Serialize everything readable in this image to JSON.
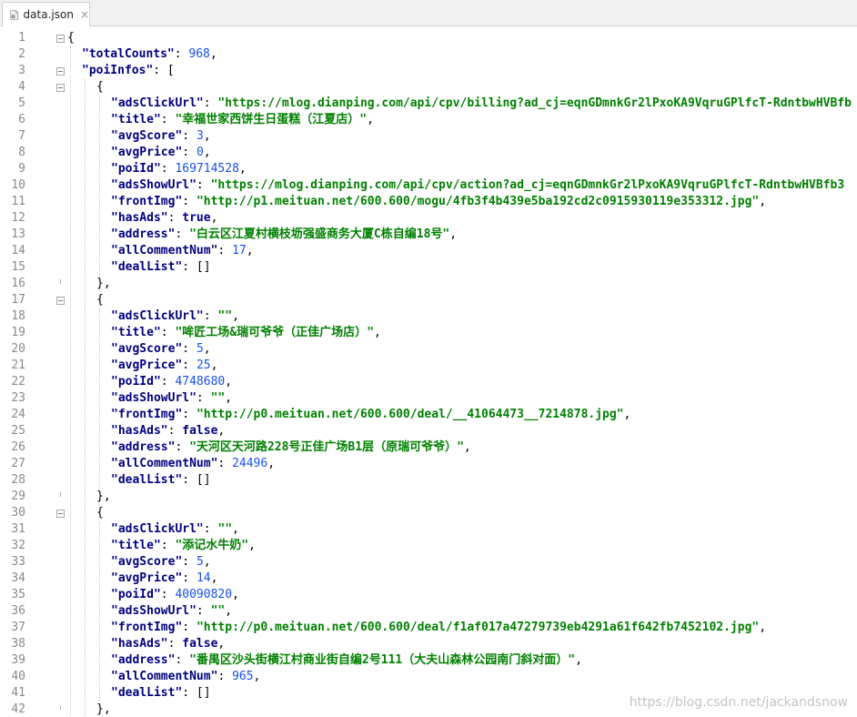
{
  "tab": {
    "label": "data.json",
    "close_glyph": "×",
    "icon": "json-file-icon"
  },
  "watermark": "https://blog.csdn.net/jackandsnow",
  "lines": [
    {
      "n": "1",
      "indent": 0,
      "t": [
        [
          "p",
          "{"
        ]
      ],
      "fold": "open"
    },
    {
      "n": "2",
      "indent": 1,
      "t": [
        [
          "ks",
          "\"totalCounts\""
        ],
        [
          "p",
          ": "
        ],
        [
          "n",
          "968"
        ],
        [
          "p",
          ","
        ]
      ]
    },
    {
      "n": "3",
      "indent": 1,
      "t": [
        [
          "ks",
          "\"poiInfos\""
        ],
        [
          "p",
          ": ["
        ]
      ],
      "fold": "open"
    },
    {
      "n": "4",
      "indent": 2,
      "t": [
        [
          "p",
          "{"
        ]
      ],
      "fold": "open"
    },
    {
      "n": "5",
      "indent": 3,
      "t": [
        [
          "ks",
          "\"adsClickUrl\""
        ],
        [
          "p",
          ": "
        ],
        [
          "s",
          "\"https://mlog.dianping.com/api/cpv/billing?ad_cj=eqnGDmnkGr2lPxoKA9VqruGPlfcT-RdntbwHVBfb"
        ]
      ]
    },
    {
      "n": "6",
      "indent": 3,
      "t": [
        [
          "ks",
          "\"title\""
        ],
        [
          "p",
          ": "
        ],
        [
          "s",
          "\"幸福世家西饼生日蛋糕（江夏店）\""
        ],
        [
          "p",
          ","
        ]
      ]
    },
    {
      "n": "7",
      "indent": 3,
      "t": [
        [
          "ks",
          "\"avgScore\""
        ],
        [
          "p",
          ": "
        ],
        [
          "n",
          "3"
        ],
        [
          "p",
          ","
        ]
      ]
    },
    {
      "n": "8",
      "indent": 3,
      "t": [
        [
          "ks",
          "\"avgPrice\""
        ],
        [
          "p",
          ": "
        ],
        [
          "n",
          "0"
        ],
        [
          "p",
          ","
        ]
      ]
    },
    {
      "n": "9",
      "indent": 3,
      "t": [
        [
          "ks",
          "\"poiId\""
        ],
        [
          "p",
          ": "
        ],
        [
          "n",
          "169714528"
        ],
        [
          "p",
          ","
        ]
      ]
    },
    {
      "n": "10",
      "indent": 3,
      "t": [
        [
          "ks",
          "\"adsShowUrl\""
        ],
        [
          "p",
          ": "
        ],
        [
          "s",
          "\"https://mlog.dianping.com/api/cpv/action?ad_cj=eqnGDmnkGr2lPxoKA9VqruGPlfcT-RdntbwHVBfb3"
        ]
      ]
    },
    {
      "n": "11",
      "indent": 3,
      "t": [
        [
          "ks",
          "\"frontImg\""
        ],
        [
          "p",
          ": "
        ],
        [
          "s",
          "\"http://p1.meituan.net/600.600/mogu/4fb3f4b439e5ba192cd2c0915930119e353312.jpg\""
        ],
        [
          "p",
          ","
        ]
      ]
    },
    {
      "n": "12",
      "indent": 3,
      "t": [
        [
          "ks",
          "\"hasAds\""
        ],
        [
          "p",
          ": "
        ],
        [
          "b",
          "true"
        ],
        [
          "p",
          ","
        ]
      ]
    },
    {
      "n": "13",
      "indent": 3,
      "t": [
        [
          "ks",
          "\"address\""
        ],
        [
          "p",
          ": "
        ],
        [
          "s",
          "\"白云区江夏村横枝坜强盛商务大厦C栋自编18号\""
        ],
        [
          "p",
          ","
        ]
      ]
    },
    {
      "n": "14",
      "indent": 3,
      "t": [
        [
          "ks",
          "\"allCommentNum\""
        ],
        [
          "p",
          ": "
        ],
        [
          "n",
          "17"
        ],
        [
          "p",
          ","
        ]
      ]
    },
    {
      "n": "15",
      "indent": 3,
      "t": [
        [
          "ks",
          "\"dealList\""
        ],
        [
          "p",
          ": []"
        ]
      ]
    },
    {
      "n": "16",
      "indent": 2,
      "t": [
        [
          "p",
          "},"
        ]
      ],
      "fold": "end"
    },
    {
      "n": "17",
      "indent": 2,
      "t": [
        [
          "p",
          "{"
        ]
      ],
      "fold": "open"
    },
    {
      "n": "18",
      "indent": 3,
      "t": [
        [
          "ks",
          "\"adsClickUrl\""
        ],
        [
          "p",
          ": "
        ],
        [
          "s",
          "\"\""
        ],
        [
          "p",
          ","
        ]
      ]
    },
    {
      "n": "19",
      "indent": 3,
      "t": [
        [
          "ks",
          "\"title\""
        ],
        [
          "p",
          ": "
        ],
        [
          "s",
          "\"哞匠工场&瑞可爷爷（正佳广场店）\""
        ],
        [
          "p",
          ","
        ]
      ]
    },
    {
      "n": "20",
      "indent": 3,
      "t": [
        [
          "ks",
          "\"avgScore\""
        ],
        [
          "p",
          ": "
        ],
        [
          "n",
          "5"
        ],
        [
          "p",
          ","
        ]
      ]
    },
    {
      "n": "21",
      "indent": 3,
      "t": [
        [
          "ks",
          "\"avgPrice\""
        ],
        [
          "p",
          ": "
        ],
        [
          "n",
          "25"
        ],
        [
          "p",
          ","
        ]
      ]
    },
    {
      "n": "22",
      "indent": 3,
      "t": [
        [
          "ks",
          "\"poiId\""
        ],
        [
          "p",
          ": "
        ],
        [
          "n",
          "4748680"
        ],
        [
          "p",
          ","
        ]
      ]
    },
    {
      "n": "23",
      "indent": 3,
      "t": [
        [
          "ks",
          "\"adsShowUrl\""
        ],
        [
          "p",
          ": "
        ],
        [
          "s",
          "\"\""
        ],
        [
          "p",
          ","
        ]
      ]
    },
    {
      "n": "24",
      "indent": 3,
      "t": [
        [
          "ks",
          "\"frontImg\""
        ],
        [
          "p",
          ": "
        ],
        [
          "s",
          "\"http://p0.meituan.net/600.600/deal/__41064473__7214878.jpg\""
        ],
        [
          "p",
          ","
        ]
      ]
    },
    {
      "n": "25",
      "indent": 3,
      "t": [
        [
          "ks",
          "\"hasAds\""
        ],
        [
          "p",
          ": "
        ],
        [
          "b",
          "false"
        ],
        [
          "p",
          ","
        ]
      ]
    },
    {
      "n": "26",
      "indent": 3,
      "t": [
        [
          "ks",
          "\"address\""
        ],
        [
          "p",
          ": "
        ],
        [
          "s",
          "\"天河区天河路228号正佳广场B1层（原瑞可爷爷）\""
        ],
        [
          "p",
          ","
        ]
      ]
    },
    {
      "n": "27",
      "indent": 3,
      "t": [
        [
          "ks",
          "\"allCommentNum\""
        ],
        [
          "p",
          ": "
        ],
        [
          "n",
          "24496"
        ],
        [
          "p",
          ","
        ]
      ]
    },
    {
      "n": "28",
      "indent": 3,
      "t": [
        [
          "ks",
          "\"dealList\""
        ],
        [
          "p",
          ": []"
        ]
      ]
    },
    {
      "n": "29",
      "indent": 2,
      "t": [
        [
          "p",
          "},"
        ]
      ],
      "fold": "end"
    },
    {
      "n": "30",
      "indent": 2,
      "t": [
        [
          "p",
          "{"
        ]
      ],
      "fold": "open"
    },
    {
      "n": "31",
      "indent": 3,
      "t": [
        [
          "ks",
          "\"adsClickUrl\""
        ],
        [
          "p",
          ": "
        ],
        [
          "s",
          "\"\""
        ],
        [
          "p",
          ","
        ]
      ]
    },
    {
      "n": "32",
      "indent": 3,
      "t": [
        [
          "ks",
          "\"title\""
        ],
        [
          "p",
          ": "
        ],
        [
          "s",
          "\"添记水牛奶\""
        ],
        [
          "p",
          ","
        ]
      ]
    },
    {
      "n": "33",
      "indent": 3,
      "t": [
        [
          "ks",
          "\"avgScore\""
        ],
        [
          "p",
          ": "
        ],
        [
          "n",
          "5"
        ],
        [
          "p",
          ","
        ]
      ]
    },
    {
      "n": "34",
      "indent": 3,
      "t": [
        [
          "ks",
          "\"avgPrice\""
        ],
        [
          "p",
          ": "
        ],
        [
          "n",
          "14"
        ],
        [
          "p",
          ","
        ]
      ]
    },
    {
      "n": "35",
      "indent": 3,
      "t": [
        [
          "ks",
          "\"poiId\""
        ],
        [
          "p",
          ": "
        ],
        [
          "n",
          "40090820"
        ],
        [
          "p",
          ","
        ]
      ]
    },
    {
      "n": "36",
      "indent": 3,
      "t": [
        [
          "ks",
          "\"adsShowUrl\""
        ],
        [
          "p",
          ": "
        ],
        [
          "s",
          "\"\""
        ],
        [
          "p",
          ","
        ]
      ]
    },
    {
      "n": "37",
      "indent": 3,
      "t": [
        [
          "ks",
          "\"frontImg\""
        ],
        [
          "p",
          ": "
        ],
        [
          "s",
          "\"http://p0.meituan.net/600.600/deal/f1af017a47279739eb4291a61f642fb7452102.jpg\""
        ],
        [
          "p",
          ","
        ]
      ]
    },
    {
      "n": "38",
      "indent": 3,
      "t": [
        [
          "ks",
          "\"hasAds\""
        ],
        [
          "p",
          ": "
        ],
        [
          "b",
          "false"
        ],
        [
          "p",
          ","
        ]
      ]
    },
    {
      "n": "39",
      "indent": 3,
      "t": [
        [
          "ks",
          "\"address\""
        ],
        [
          "p",
          ": "
        ],
        [
          "s",
          "\"番禺区沙头街横江村商业街自编2号111（大夫山森林公园南门斜对面）\""
        ],
        [
          "p",
          ","
        ]
      ]
    },
    {
      "n": "40",
      "indent": 3,
      "t": [
        [
          "ks",
          "\"allCommentNum\""
        ],
        [
          "p",
          ": "
        ],
        [
          "n",
          "965"
        ],
        [
          "p",
          ","
        ]
      ]
    },
    {
      "n": "41",
      "indent": 3,
      "t": [
        [
          "ks",
          "\"dealList\""
        ],
        [
          "p",
          ": []"
        ]
      ]
    },
    {
      "n": "42",
      "indent": 2,
      "t": [
        [
          "p",
          "},"
        ]
      ],
      "fold": "end"
    }
  ]
}
